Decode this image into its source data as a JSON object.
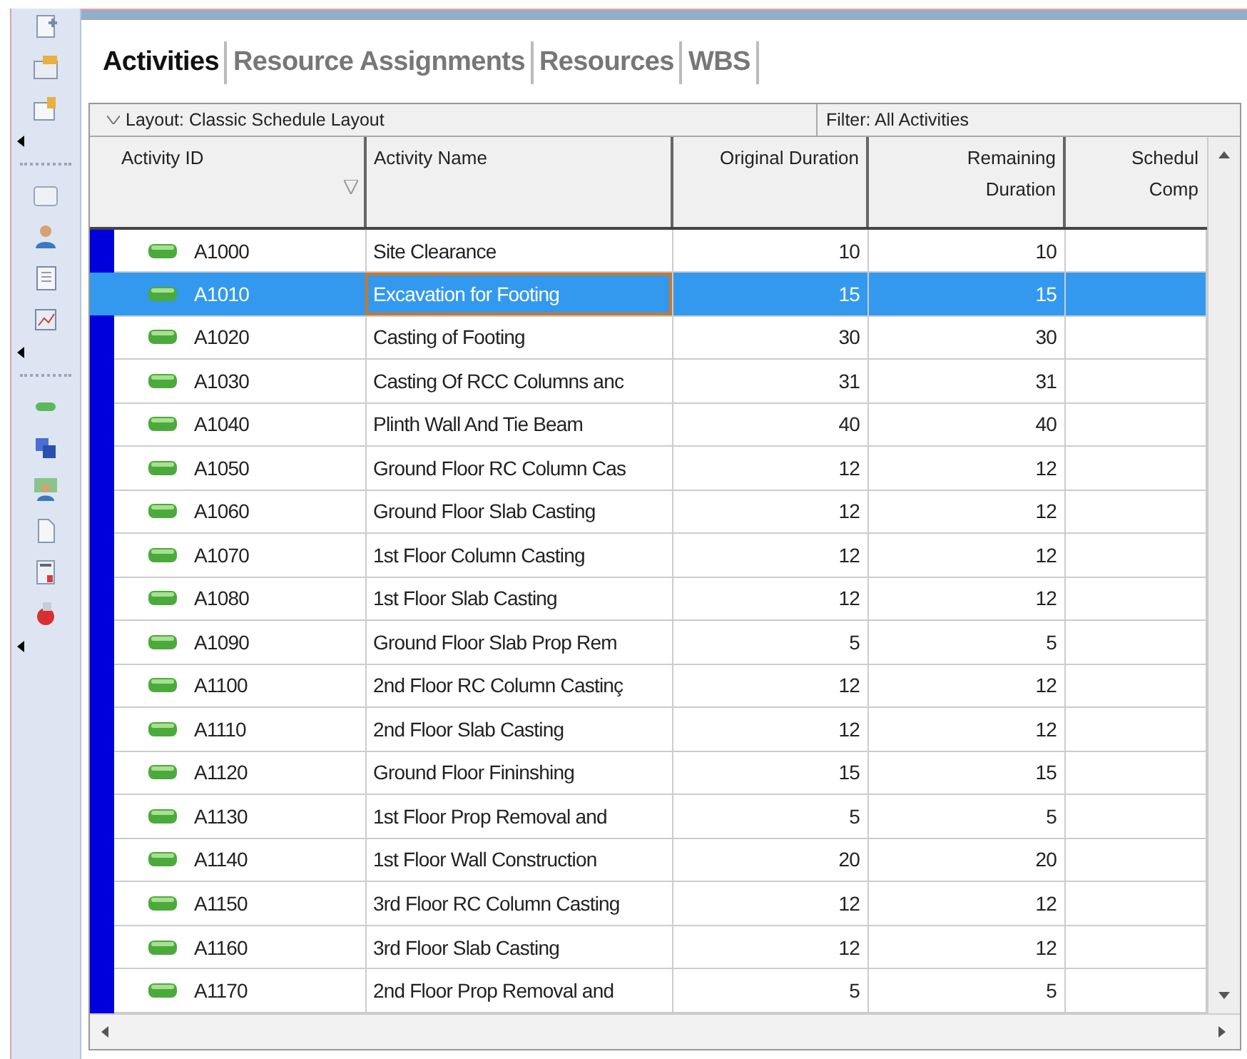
{
  "tabs": [
    {
      "label": "Activities",
      "selected": true
    },
    {
      "label": "Resource Assignments",
      "selected": false
    },
    {
      "label": "Resources",
      "selected": false
    },
    {
      "label": "WBS",
      "selected": false
    }
  ],
  "layout_bar": {
    "layout": "Layout: Classic Schedule Layout",
    "filter": "Filter: All Activities"
  },
  "table": {
    "columns": [
      "Activity ID",
      "Activity Name",
      "Original Duration",
      "Remaining Duration",
      "Schedul Comp"
    ],
    "rows": [
      {
        "id": "A1000",
        "name": "Site Clearance",
        "original_duration": "10",
        "remaining_duration": "10",
        "selected": false
      },
      {
        "id": "A1010",
        "name": "Excavation for Footing",
        "original_duration": "15",
        "remaining_duration": "15",
        "selected": true
      },
      {
        "id": "A1020",
        "name": "Casting of Footing",
        "original_duration": "30",
        "remaining_duration": "30",
        "selected": false
      },
      {
        "id": "A1030",
        "name": "Casting Of RCC Columns anc",
        "original_duration": "31",
        "remaining_duration": "31",
        "selected": false
      },
      {
        "id": "A1040",
        "name": "Plinth Wall And Tie Beam",
        "original_duration": "40",
        "remaining_duration": "40",
        "selected": false
      },
      {
        "id": "A1050",
        "name": "Ground Floor RC Column Cas",
        "original_duration": "12",
        "remaining_duration": "12",
        "selected": false
      },
      {
        "id": "A1060",
        "name": "Ground Floor Slab Casting",
        "original_duration": "12",
        "remaining_duration": "12",
        "selected": false
      },
      {
        "id": "A1070",
        "name": "1st Floor Column Casting",
        "original_duration": "12",
        "remaining_duration": "12",
        "selected": false
      },
      {
        "id": "A1080",
        "name": "1st Floor Slab Casting",
        "original_duration": "12",
        "remaining_duration": "12",
        "selected": false
      },
      {
        "id": "A1090",
        "name": "Ground Floor Slab Prop Rem",
        "original_duration": "5",
        "remaining_duration": "5",
        "selected": false
      },
      {
        "id": "A1100",
        "name": "2nd Floor RC Column Castinç",
        "original_duration": "12",
        "remaining_duration": "12",
        "selected": false
      },
      {
        "id": "A1110",
        "name": "2nd Floor Slab Casting",
        "original_duration": "12",
        "remaining_duration": "12",
        "selected": false
      },
      {
        "id": "A1120",
        "name": "Ground Floor Fininshing",
        "original_duration": "15",
        "remaining_duration": "15",
        "selected": false
      },
      {
        "id": "A1130",
        "name": "1st Floor Prop Removal and",
        "original_duration": "5",
        "remaining_duration": "5",
        "selected": false
      },
      {
        "id": "A1140",
        "name": "1st Floor Wall Construction",
        "original_duration": "20",
        "remaining_duration": "20",
        "selected": false
      },
      {
        "id": "A1150",
        "name": "3rd Floor RC Column Casting",
        "original_duration": "12",
        "remaining_duration": "12",
        "selected": false
      },
      {
        "id": "A1160",
        "name": "3rd Floor Slab Casting",
        "original_duration": "12",
        "remaining_duration": "12",
        "selected": false
      },
      {
        "id": "A1170",
        "name": "2nd Floor Prop Removal and",
        "original_duration": "5",
        "remaining_duration": "5",
        "selected": false
      }
    ]
  }
}
